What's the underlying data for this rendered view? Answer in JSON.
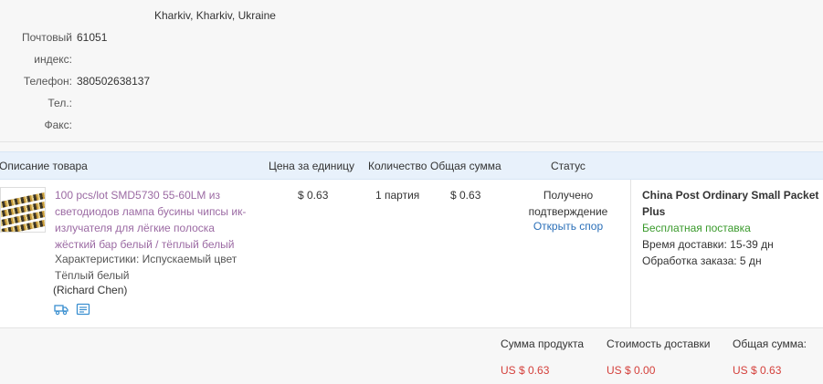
{
  "address": {
    "city_line": "Kharkiv, Kharkiv, Ukraine",
    "postal_label_1": "Почтовый",
    "postal_label_2": "индекс:",
    "postal_value": "61051",
    "phone_label": "Телефон:",
    "phone_value": "380502638137",
    "tel_label": "Тел.:",
    "tel_value": "",
    "fax_label": "Факс:",
    "fax_value": ""
  },
  "table": {
    "headers": {
      "description": "Описание товара",
      "unit_price": "Цена за единицу",
      "quantity": "Количество",
      "total": "Общая сумма",
      "status": "Статус"
    },
    "row": {
      "title_lines": [
        "100 pcs/lot SMD5730 55-60LM из",
        "светодиодов лампа бусины чипсы ик-",
        "излучателя для лёгкие полоска",
        "жёсткий бар белый / тёплый белый"
      ],
      "props_lines": [
        "Характеристики: Испускаемый цвет",
        "Тёплый белый"
      ],
      "seller": "(Richard Chen)",
      "icons": [
        "delivery-truck-icon",
        "order-snapshot-icon"
      ],
      "unit_price": "$ 0.63",
      "quantity": "1 партия",
      "total": "$ 0.63",
      "status_lines": [
        "Получено",
        "подтверждение"
      ],
      "dispute_link": "Открыть спор",
      "shipping": {
        "method_lines": [
          "China Post Ordinary Small Packet",
          "Plus"
        ],
        "free_label": "Бесплатная поставка",
        "delivery_time": "Время доставки:  15-39 дн",
        "processing_time": "Обработка заказа:  5 дн"
      }
    }
  },
  "totals": {
    "product_label": "Сумма продукта",
    "product_value": "US $ 0.63",
    "shipping_label": "Стоимость доставки",
    "shipping_value": "US $ 0.00",
    "grand_label": "Общая сумма:",
    "grand_value": "US $ 0.63"
  },
  "colors": {
    "link_purple": "#9b6aa3",
    "link_blue": "#2a6fb8",
    "free_green": "#3a9a2c",
    "price_red": "#d43f3a",
    "header_bg": "#e8f1fb"
  }
}
